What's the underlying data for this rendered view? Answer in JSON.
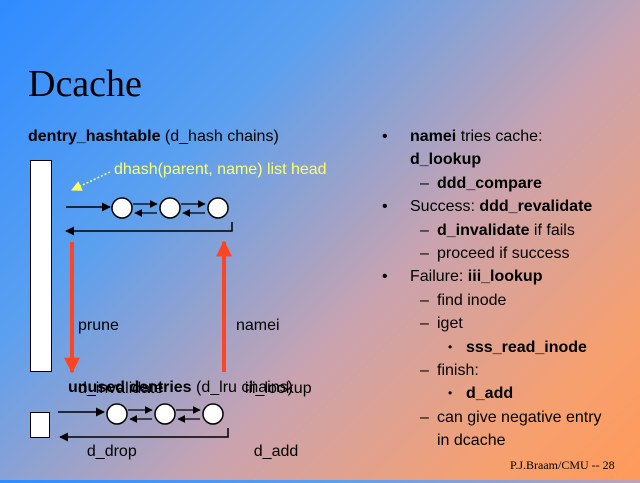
{
  "title": "Dcache",
  "left": {
    "hash_heading_bold": "dentry_hashtable",
    "hash_heading_rest": " (d_hash chains)",
    "head_label": "dhash(parent, name) list head",
    "prune_lines": [
      "prune",
      "d_invalidate",
      "  d_drop"
    ],
    "namei_lines": [
      "namei",
      "  iii_lookup",
      "    d_add"
    ],
    "unused_heading_bold": "unused dentries",
    "unused_heading_rest": " (d_lru chains)"
  },
  "bullets": [
    {
      "level": 1,
      "marker": "•",
      "parts": [
        {
          "t": "namei",
          "b": true
        },
        {
          "t": " tries cache:",
          "b": false
        }
      ]
    },
    {
      "level": 1,
      "marker": "",
      "parts": [
        {
          "t": "d_lookup",
          "b": true
        }
      ]
    },
    {
      "level": 2,
      "marker": "–",
      "parts": [
        {
          "t": "ddd_compare",
          "b": true
        }
      ]
    },
    {
      "level": 1,
      "marker": "•",
      "parts": [
        {
          "t": "Success: ",
          "b": false
        },
        {
          "t": "ddd_revalidate",
          "b": true
        }
      ]
    },
    {
      "level": 2,
      "marker": "–",
      "parts": [
        {
          "t": "d_invalidate",
          "b": true
        },
        {
          "t": " if fails",
          "b": false
        }
      ]
    },
    {
      "level": 2,
      "marker": "–",
      "parts": [
        {
          "t": "proceed if success",
          "b": false
        }
      ]
    },
    {
      "level": 1,
      "marker": "•",
      "parts": [
        {
          "t": "Failure: ",
          "b": false
        },
        {
          "t": "iii_lookup",
          "b": true
        }
      ]
    },
    {
      "level": 2,
      "marker": "–",
      "parts": [
        {
          "t": "find inode",
          "b": false
        }
      ]
    },
    {
      "level": 2,
      "marker": "–",
      "parts": [
        {
          "t": "iget",
          "b": false
        }
      ]
    },
    {
      "level": 3,
      "marker": "•",
      "parts": [
        {
          "t": "sss_read_inode",
          "b": true
        }
      ]
    },
    {
      "level": 2,
      "marker": "–",
      "parts": [
        {
          "t": "finish:",
          "b": false
        }
      ]
    },
    {
      "level": 3,
      "marker": "•",
      "parts": [
        {
          "t": "d_add",
          "b": true
        }
      ]
    },
    {
      "level": 2,
      "marker": "–",
      "parts": [
        {
          "t": "can give negative entry",
          "b": false
        }
      ]
    },
    {
      "level": 2,
      "marker": "",
      "parts": [
        {
          "t": "in dcache",
          "b": false
        }
      ]
    }
  ],
  "footer": "P.J.Braam/CMU -- 28",
  "colors": {
    "label": "#ffff66",
    "arrow_red": "#ff4422",
    "node_fill": "#ffffff"
  }
}
